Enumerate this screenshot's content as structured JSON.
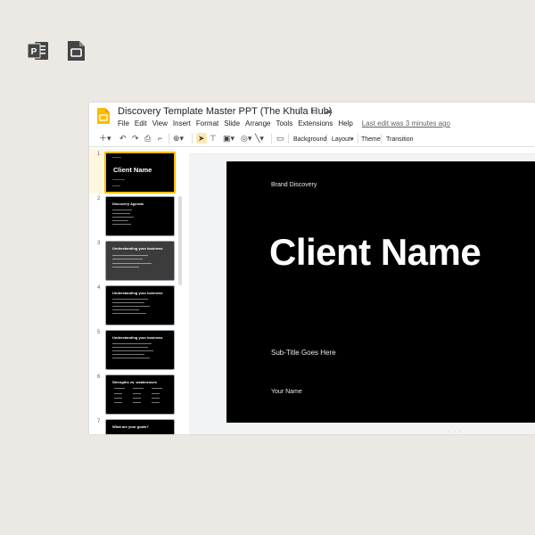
{
  "doc": {
    "title": "Discovery Template Master PPT (The Khula Hub)",
    "last_edit": "Last edit was 3 minutes ago"
  },
  "menu": [
    "File",
    "Edit",
    "View",
    "Insert",
    "Format",
    "Slide",
    "Arrange",
    "Tools",
    "Extensions",
    "Help"
  ],
  "toolbar": {
    "background": "Background",
    "layout": "Layout",
    "theme": "Theme",
    "transition": "Transition"
  },
  "thumbnails": [
    {
      "num": "1",
      "title": "Client Name"
    },
    {
      "num": "2",
      "title": "Discovery Agenda"
    },
    {
      "num": "3",
      "title": "Understanding your business"
    },
    {
      "num": "4",
      "title": "Understanding your business"
    },
    {
      "num": "5",
      "title": "Understanding your business"
    },
    {
      "num": "6",
      "title": "Strengths vs. weaknesses"
    },
    {
      "num": "7",
      "title": "What are your goals?"
    }
  ],
  "slide": {
    "eyebrow": "Brand Discovery",
    "title": "Client Name",
    "subtitle": "Sub-Title Goes Here",
    "name": "Your Name"
  },
  "colors": {
    "ppt_brand": "#444444",
    "slides_brand": "#444444",
    "slides_logo": "#fbbc04",
    "selection": "#fbbc04",
    "slide_bg": "#000000"
  }
}
